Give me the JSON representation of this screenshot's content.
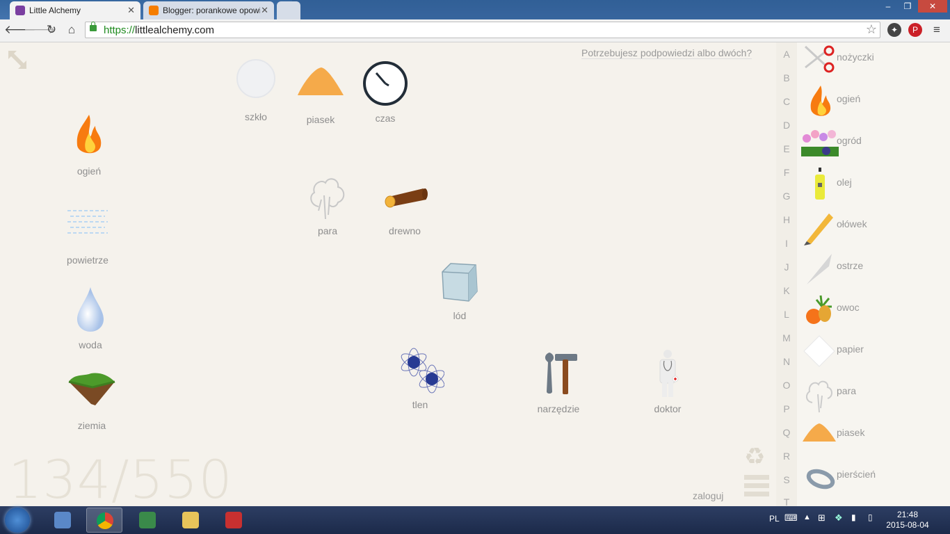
{
  "browser": {
    "tabs": [
      {
        "title": "Little Alchemy",
        "favicon_color": "#7a3fa0",
        "active": true
      },
      {
        "title": "Blogger: porankowe opowi",
        "favicon_color": "#f57d00",
        "active": false
      }
    ],
    "url_scheme": "https://",
    "url_host": "littlealchemy.com",
    "window_buttons": {
      "minimize": "–",
      "maximize": "❐",
      "close": "✕"
    }
  },
  "game": {
    "hint": "Potrzebujesz podpowiedzi albo dwóch?",
    "counter": "134/550",
    "login": "zaloguj",
    "workspace": [
      {
        "name": "ogień",
        "icon": "fire-icon"
      },
      {
        "name": "powietrze",
        "icon": "air-icon"
      },
      {
        "name": "woda",
        "icon": "water-drop-icon"
      },
      {
        "name": "ziemia",
        "icon": "earth-icon"
      },
      {
        "name": "szkło",
        "icon": "glass-icon"
      },
      {
        "name": "piasek",
        "icon": "sand-icon"
      },
      {
        "name": "czas",
        "icon": "clock-icon"
      },
      {
        "name": "para",
        "icon": "steam-icon"
      },
      {
        "name": "drewno",
        "icon": "wood-log-icon"
      },
      {
        "name": "lód",
        "icon": "ice-cube-icon"
      },
      {
        "name": "tlen",
        "icon": "oxygen-icon"
      },
      {
        "name": "narzędzie",
        "icon": "tools-icon"
      },
      {
        "name": "doktor",
        "icon": "doctor-icon"
      }
    ],
    "alphabet": [
      "A",
      "B",
      "C",
      "D",
      "E",
      "F",
      "G",
      "H",
      "I",
      "J",
      "K",
      "L",
      "M",
      "N",
      "O",
      "P",
      "Q",
      "R",
      "S",
      "T"
    ],
    "library": [
      {
        "name": "nożyczki",
        "icon": "scissors-icon"
      },
      {
        "name": "ogień",
        "icon": "fire-icon"
      },
      {
        "name": "ogród",
        "icon": "garden-icon"
      },
      {
        "name": "olej",
        "icon": "oil-bottle-icon"
      },
      {
        "name": "ołówek",
        "icon": "pencil-icon"
      },
      {
        "name": "ostrze",
        "icon": "blade-icon"
      },
      {
        "name": "owoc",
        "icon": "fruit-icon"
      },
      {
        "name": "papier",
        "icon": "paper-icon"
      },
      {
        "name": "para",
        "icon": "steam-icon"
      },
      {
        "name": "piasek",
        "icon": "sand-icon"
      },
      {
        "name": "pierścień",
        "icon": "ring-icon"
      }
    ]
  },
  "taskbar": {
    "language": "PL",
    "time": "21:48",
    "date": "2015-08-04"
  },
  "colors": {
    "background": "#f5f2ec",
    "label": "#8e8e8e",
    "accent_fire": "#f77b10",
    "taskbar": "#1c2a4a"
  }
}
